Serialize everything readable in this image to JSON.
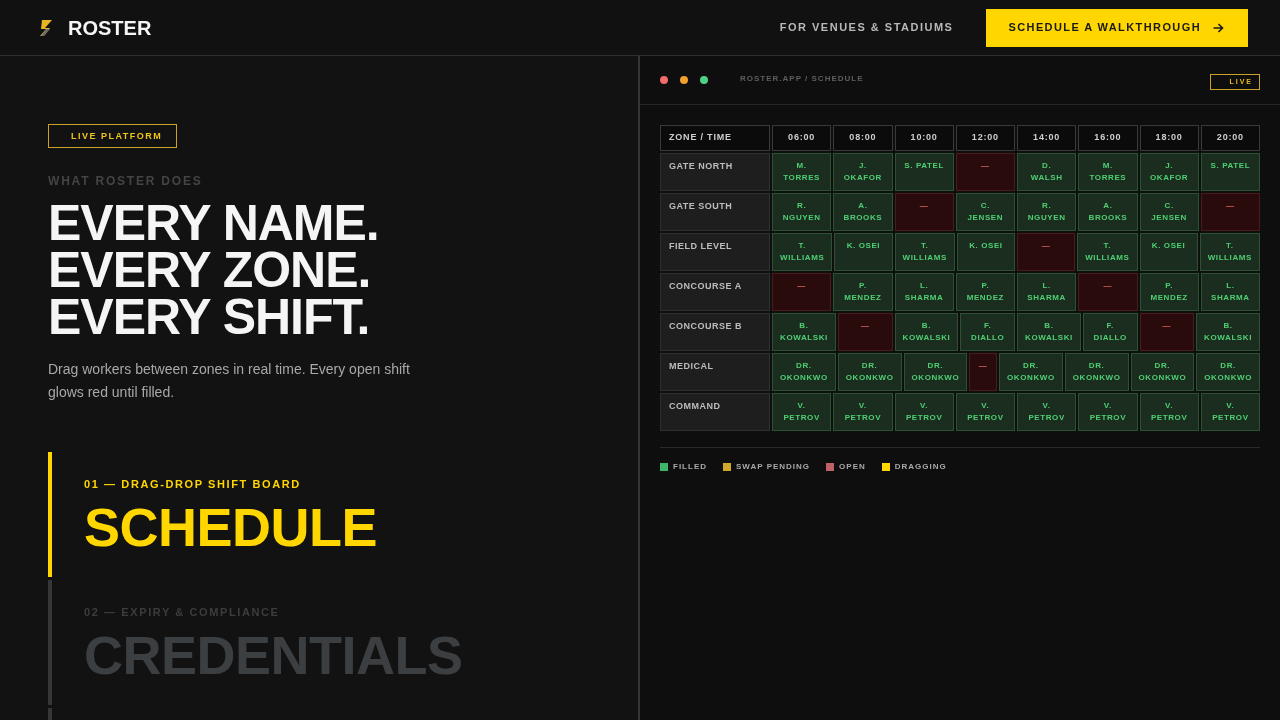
{
  "header": {
    "brand": "ROSTER",
    "nav_link": "FOR VENUES & STADIUMS",
    "cta": "SCHEDULE A WALKTHROUGH"
  },
  "hero": {
    "badge": "LIVE PLATFORM",
    "eyebrow": "WHAT ROSTER DOES",
    "headline": [
      "EVERY NAME.",
      "EVERY ZONE.",
      "EVERY SHIFT."
    ],
    "description": "Drag workers between zones in real time. Every open shift glows red until filled."
  },
  "features": [
    {
      "label": "01 — DRAG-DROP SHIFT BOARD",
      "title": "SCHEDULE",
      "selected": true
    },
    {
      "label": "02 — EXPIRY & COMPLIANCE",
      "title": "CREDENTIALS",
      "selected": false
    }
  ],
  "app_window": {
    "address": "ROSTER.APP / SCHEDULE",
    "badge": "LIVE",
    "schedule": {
      "columns": [
        "ZONE / TIME",
        "06:00",
        "08:00",
        "10:00",
        "12:00",
        "14:00",
        "16:00",
        "18:00",
        "20:00"
      ],
      "rows": [
        {
          "zone": "GATE NORTH",
          "shifts": [
            {
              "kind": "filled",
              "text": "M. TORRES"
            },
            {
              "kind": "filled",
              "text": "J. OKAFOR"
            },
            {
              "kind": "filled",
              "text": "S. PATEL"
            },
            {
              "kind": "open",
              "text": "—"
            },
            {
              "kind": "filled",
              "text": "D. WALSH"
            },
            {
              "kind": "filled",
              "text": "M. TORRES"
            },
            {
              "kind": "filled",
              "text": "J. OKAFOR"
            },
            {
              "kind": "filled",
              "text": "S. PATEL"
            }
          ]
        },
        {
          "zone": "GATE SOUTH",
          "shifts": [
            {
              "kind": "filled",
              "text": "R. NGUYEN"
            },
            {
              "kind": "filled",
              "text": "A. BROOKS"
            },
            {
              "kind": "open",
              "text": "—"
            },
            {
              "kind": "filled",
              "text": "C. JENSEN"
            },
            {
              "kind": "filled",
              "text": "R. NGUYEN"
            },
            {
              "kind": "filled",
              "text": "A. BROOKS"
            },
            {
              "kind": "filled",
              "text": "C. JENSEN"
            },
            {
              "kind": "open",
              "text": "—"
            }
          ]
        },
        {
          "zone": "FIELD LEVEL",
          "shifts": [
            {
              "kind": "filled",
              "text": "T. WILLIAMS"
            },
            {
              "kind": "filled",
              "text": "K. OSEI"
            },
            {
              "kind": "filled",
              "text": "T. WILLIAMS"
            },
            {
              "kind": "filled",
              "text": "K. OSEI"
            },
            {
              "kind": "open",
              "text": "—"
            },
            {
              "kind": "filled",
              "text": "T. WILLIAMS"
            },
            {
              "kind": "filled",
              "text": "K. OSEI"
            },
            {
              "kind": "filled",
              "text": "T. WILLIAMS"
            }
          ]
        },
        {
          "zone": "CONCOURSE A",
          "shifts": [
            {
              "kind": "open",
              "text": "—"
            },
            {
              "kind": "filled",
              "text": "P. MENDEZ"
            },
            {
              "kind": "filled",
              "text": "L. SHARMA"
            },
            {
              "kind": "filled",
              "text": "P. MENDEZ"
            },
            {
              "kind": "filled",
              "text": "L. SHARMA"
            },
            {
              "kind": "open",
              "text": "—"
            },
            {
              "kind": "filled",
              "text": "P. MENDEZ"
            },
            {
              "kind": "filled",
              "text": "L. SHARMA"
            }
          ]
        },
        {
          "zone": "CONCOURSE B",
          "shifts": [
            {
              "kind": "filled",
              "text": "B. KOWALSKI"
            },
            {
              "kind": "open",
              "text": "—"
            },
            {
              "kind": "filled",
              "text": "B. KOWALSKI"
            },
            {
              "kind": "filled",
              "text": "F. DIALLO"
            },
            {
              "kind": "filled",
              "text": "B. KOWALSKI"
            },
            {
              "kind": "filled",
              "text": "F. DIALLO"
            },
            {
              "kind": "open",
              "text": "—"
            },
            {
              "kind": "filled",
              "text": "B. KOWALSKI"
            }
          ]
        },
        {
          "zone": "MEDICAL",
          "shifts": [
            {
              "kind": "filled",
              "text": "DR. OKONKWO"
            },
            {
              "kind": "filled",
              "text": "DR. OKONKWO"
            },
            {
              "kind": "filled",
              "text": "DR. OKONKWO"
            },
            {
              "kind": "open",
              "text": "—"
            },
            {
              "kind": "filled",
              "text": "DR. OKONKWO"
            },
            {
              "kind": "filled",
              "text": "DR. OKONKWO"
            },
            {
              "kind": "filled",
              "text": "DR. OKONKWO"
            },
            {
              "kind": "filled",
              "text": "DR. OKONKWO"
            }
          ]
        },
        {
          "zone": "COMMAND",
          "shifts": [
            {
              "kind": "filled",
              "text": "V. PETROV"
            },
            {
              "kind": "filled",
              "text": "V. PETROV"
            },
            {
              "kind": "filled",
              "text": "V. PETROV"
            },
            {
              "kind": "filled",
              "text": "V. PETROV"
            },
            {
              "kind": "filled",
              "text": "V. PETROV"
            },
            {
              "kind": "filled",
              "text": "V. PETROV"
            },
            {
              "kind": "filled",
              "text": "V. PETROV"
            },
            {
              "kind": "filled",
              "text": "V. PETROV"
            }
          ]
        }
      ]
    },
    "legend": [
      {
        "label": "FILLED",
        "color": "#3fb56a"
      },
      {
        "label": "SWAP PENDING",
        "color": "#d2a62a"
      },
      {
        "label": "OPEN",
        "color": "#c0616a"
      },
      {
        "label": "DRAGGING",
        "color": "#ffd600"
      }
    ]
  }
}
